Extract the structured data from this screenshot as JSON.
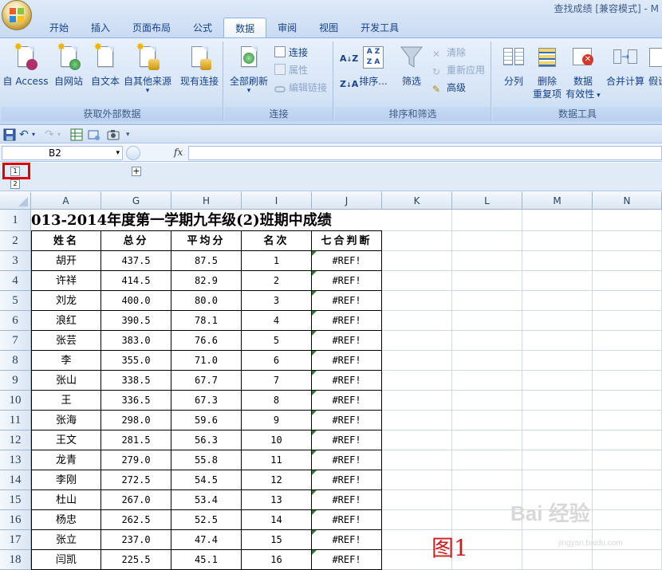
{
  "window": {
    "title": "查找成绩 [兼容模式] - M"
  },
  "tabs": [
    "开始",
    "插入",
    "页面布局",
    "公式",
    "数据",
    "审阅",
    "视图",
    "开发工具"
  ],
  "active_tab": "数据",
  "ribbon": {
    "group_external": {
      "label": "获取外部数据",
      "from_access": "自 Access",
      "from_web": "自网站",
      "from_text": "自文本",
      "from_other": "自其他来源",
      "existing": "现有连接"
    },
    "group_connections": {
      "label": "连接",
      "refresh_all": "全部刷新",
      "connections": "连接",
      "properties": "属性",
      "edit_links": "编辑链接"
    },
    "group_sort": {
      "label": "排序和筛选",
      "sort_az": "A↓Z",
      "sort_za": "Z↓A",
      "sort": "排序...",
      "filter": "筛选",
      "clear": "清除",
      "reapply": "重新应用",
      "advanced": "高级"
    },
    "group_tools": {
      "label": "数据工具",
      "text_to_columns": "分列",
      "remove_dup_1": "删除",
      "remove_dup_2": "重复项",
      "validation_1": "数据",
      "validation_2": "有效性",
      "consolidate": "合并计算",
      "whatif": "假设"
    }
  },
  "name_box": "B2",
  "fx_label": "fx",
  "outline": {
    "level1": "1",
    "level2": "2",
    "expand": "+"
  },
  "columns": [
    "A",
    "G",
    "H",
    "I",
    "J",
    "K",
    "L",
    "M",
    "N"
  ],
  "row_numbers": [
    "1",
    "2",
    "3",
    "4",
    "5",
    "6",
    "7",
    "8",
    "9",
    "10",
    "11",
    "12",
    "13",
    "14",
    "15",
    "16",
    "17",
    "18"
  ],
  "sheet": {
    "title": "013-2014年度第一学期九年级(2)班期中成绩",
    "headers": [
      "姓名",
      "总分",
      "平均分",
      "名次",
      "七合判断"
    ],
    "rows": [
      [
        "胡开",
        "437.5",
        "87.5",
        "1",
        "#REF!"
      ],
      [
        "许祥",
        "414.5",
        "82.9",
        "2",
        "#REF!"
      ],
      [
        "刘龙",
        "400.0",
        "80.0",
        "3",
        "#REF!"
      ],
      [
        "浪红",
        "390.5",
        "78.1",
        "4",
        "#REF!"
      ],
      [
        "张芸",
        "383.0",
        "76.6",
        "5",
        "#REF!"
      ],
      [
        "李",
        "355.0",
        "71.0",
        "6",
        "#REF!"
      ],
      [
        "张山",
        "338.5",
        "67.7",
        "7",
        "#REF!"
      ],
      [
        "王",
        "336.5",
        "67.3",
        "8",
        "#REF!"
      ],
      [
        "张海",
        "298.0",
        "59.6",
        "9",
        "#REF!"
      ],
      [
        "王文",
        "281.5",
        "56.3",
        "10",
        "#REF!"
      ],
      [
        "龙青",
        "279.0",
        "55.8",
        "11",
        "#REF!"
      ],
      [
        "李刚",
        "272.5",
        "54.5",
        "12",
        "#REF!"
      ],
      [
        "杜山",
        "267.0",
        "53.4",
        "13",
        "#REF!"
      ],
      [
        "杨忠",
        "262.5",
        "52.5",
        "14",
        "#REF!"
      ],
      [
        "张立",
        "237.0",
        "47.4",
        "15",
        "#REF!"
      ],
      [
        "闫凯",
        "225.5",
        "45.1",
        "16",
        "#REF!"
      ]
    ]
  },
  "figure_label": "图1",
  "watermark": {
    "brand": "Bai 经验",
    "url": "jingyan.baidu.com"
  },
  "colors": {
    "ribbon_blue": "#d4e3f6",
    "text_blue": "#15428b",
    "highlight_red": "#e00000",
    "selected_header": "#f4c76b"
  }
}
